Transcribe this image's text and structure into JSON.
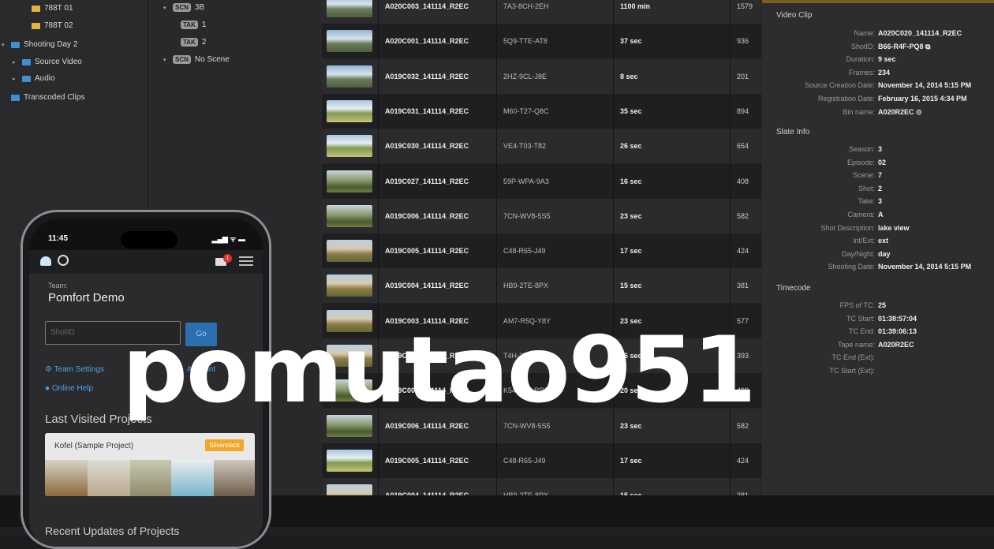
{
  "tree": {
    "items": [
      {
        "label": "788T 01",
        "color": "yellow",
        "indent": 2,
        "caret": ""
      },
      {
        "label": "788T 02",
        "color": "yellow",
        "indent": 2,
        "caret": ""
      },
      {
        "label": "Shooting Day 2",
        "color": "blue",
        "indent": 0,
        "caret": "▾"
      },
      {
        "label": "Source Video",
        "color": "blue",
        "indent": 1,
        "caret": "▸"
      },
      {
        "label": "Audio",
        "color": "blue",
        "indent": 1,
        "caret": "▸"
      },
      {
        "label": "Transcoded Clips",
        "color": "blue",
        "indent": 0,
        "caret": ""
      }
    ]
  },
  "tree2": {
    "items": [
      {
        "tag": "SCN",
        "label": "3B"
      },
      {
        "tag": "TAK",
        "label": "1"
      },
      {
        "tag": "TAK",
        "label": "2"
      },
      {
        "tag": "SCN",
        "label": "No Scene"
      }
    ]
  },
  "table": {
    "rows": [
      {
        "name": "A020C003_141114_R2EC",
        "id": "7A3-8CH-2EH",
        "duration": "1100 min",
        "frames": "1579",
        "thumb": "mountain"
      },
      {
        "name": "A020C001_141114_R2EC",
        "id": "5Q9-TTE-AT8",
        "duration": "37 sec",
        "frames": "936",
        "thumb": "mountain"
      },
      {
        "name": "A019C032_141114_R2EC",
        "id": "2HZ-9CL-J8E",
        "duration": "8 sec",
        "frames": "201",
        "thumb": "mountain"
      },
      {
        "name": "A019C031_141114_R2EC",
        "id": "M60-T27-Q8C",
        "duration": "35 sec",
        "frames": "894",
        "thumb": "meadow"
      },
      {
        "name": "A019C030_141114_R2EC",
        "id": "VE4-T03-T82",
        "duration": "26 sec",
        "frames": "654",
        "thumb": "meadow"
      },
      {
        "name": "A019C027_141114_R2EC",
        "id": "59P-WPA-9A3",
        "duration": "16 sec",
        "frames": "408",
        "thumb": "forest"
      },
      {
        "name": "A019C006_141114_R2EC",
        "id": "7CN-WV8-5S5",
        "duration": "23 sec",
        "frames": "582",
        "thumb": "forest"
      },
      {
        "name": "A019C005_141114_R2EC",
        "id": "C48-R65-J49",
        "duration": "17 sec",
        "frames": "424",
        "thumb": "tree"
      },
      {
        "name": "A019C004_141114_R2EC",
        "id": "HB9-2TE-8PX",
        "duration": "15 sec",
        "frames": "381",
        "thumb": "tree"
      },
      {
        "name": "A019C003_141114_R2EC",
        "id": "AM7-R5Q-Y8Y",
        "duration": "23 sec",
        "frames": "577",
        "thumb": "tree"
      },
      {
        "name": "A019C002_141114_R2EC",
        "id": "T4H-352-L48",
        "duration": "16 sec",
        "frames": "393",
        "thumb": "tree"
      },
      {
        "name": "A019C001_141114_R2EC",
        "id": "K54-R3V-RR3",
        "duration": "20 sec",
        "frames": "499",
        "thumb": "forest"
      },
      {
        "name": "A019C006_141114_R2EC",
        "id": "7CN-WV8-5S5",
        "duration": "23 sec",
        "frames": "582",
        "thumb": "forest"
      },
      {
        "name": "A019C005_141114_R2EC",
        "id": "C48-R65-J49",
        "duration": "17 sec",
        "frames": "424",
        "thumb": "meadow"
      },
      {
        "name": "A019C004_141114_R2EC",
        "id": "HB9-2TE-8PX",
        "duration": "15 sec",
        "frames": "381",
        "thumb": "tree"
      }
    ]
  },
  "panel": {
    "video_title": "Video Clip",
    "video": [
      {
        "k": "Name:",
        "v": "A020C020_141114_R2EC"
      },
      {
        "k": "ShotID:",
        "v": "B66-R4F-PQ8 ⧉"
      },
      {
        "k": "Duration:",
        "v": "9 sec"
      },
      {
        "k": "Frames:",
        "v": "234"
      },
      {
        "k": "Source Creation Date:",
        "v": "November 14, 2014 5:15 PM"
      },
      {
        "k": "Registration Date:",
        "v": "February 16, 2015 4:34 PM"
      },
      {
        "k": "Bin name:",
        "v": "A020R2EC ⊙"
      }
    ],
    "slate_title": "Slate Info",
    "slate": [
      {
        "k": "Season:",
        "v": "3"
      },
      {
        "k": "Episode:",
        "v": "02"
      },
      {
        "k": "Scene:",
        "v": "7"
      },
      {
        "k": "Shot:",
        "v": "2"
      },
      {
        "k": "Take:",
        "v": "3"
      },
      {
        "k": "Camera:",
        "v": "A"
      },
      {
        "k": "Shot Description:",
        "v": "lake view"
      },
      {
        "k": "Int/Ext:",
        "v": "ext"
      },
      {
        "k": "Day/Night:",
        "v": "day"
      },
      {
        "k": "Shooting Date:",
        "v": "November 14, 2014 5:15 PM"
      }
    ],
    "tc_title": "Timecode",
    "tc": [
      {
        "k": "FPS of TC:",
        "v": "25"
      },
      {
        "k": "TC Start:",
        "v": "01:38:57:04"
      },
      {
        "k": "TC End:",
        "v": "01:39:06:13"
      },
      {
        "k": "Tape name:",
        "v": "A020R2EC"
      },
      {
        "k": "TC End (Ext):",
        "v": ""
      },
      {
        "k": "TC Start (Ext):",
        "v": ""
      }
    ]
  },
  "phone": {
    "time": "11:45",
    "signal": "▂▄▆ ᯤ ▬",
    "notification_count": "1",
    "team_label": "Team:",
    "team_name": "Pomfort Demo",
    "shotid_placeholder": "ShotID",
    "go_label": "Go",
    "team_settings": "Team Settings",
    "account": "Account",
    "online_help": "Online Help",
    "last_visited": "Last Visited Projects",
    "project_name": "Kofel (Sample Project)",
    "project_badge": "Silverstack",
    "recent_updates": "Recent Updates of Projects"
  },
  "watermark": "pomutao951"
}
